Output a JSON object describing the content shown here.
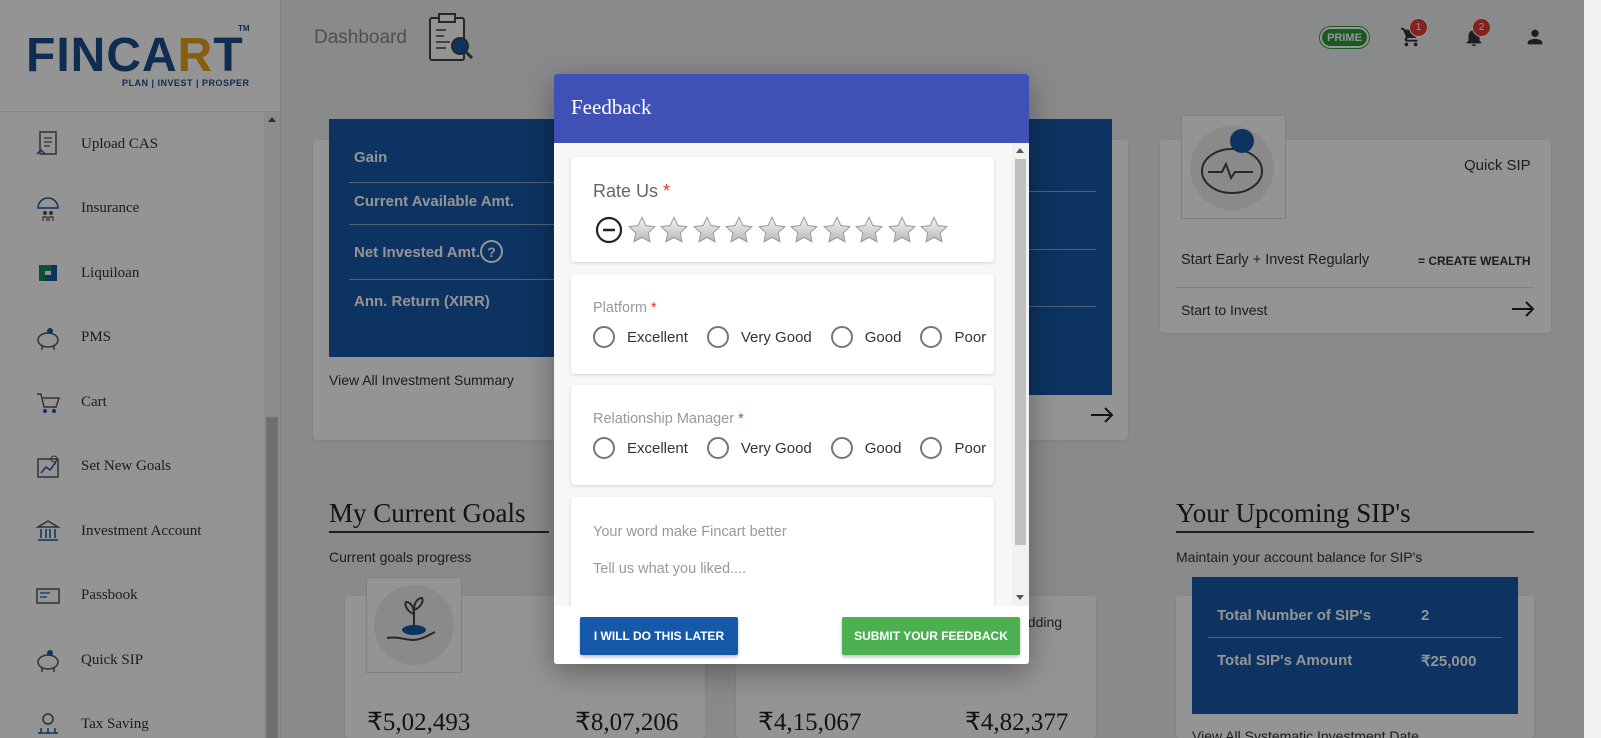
{
  "sidebar": {
    "brand": {
      "prefix": "FINCA",
      "accent": "R",
      "suffix": "T",
      "tm": "TM",
      "tagline": "PLAN | INVEST | PROSPER"
    },
    "items": [
      {
        "label": "Upload CAS",
        "icon": "upload-document-icon"
      },
      {
        "label": "Insurance",
        "icon": "umbrella-family-icon"
      },
      {
        "label": "Liquiloan",
        "icon": "liquiloan-logo-icon"
      },
      {
        "label": "PMS",
        "icon": "piggy-bank-icon"
      },
      {
        "label": "Cart",
        "icon": "cart-icon"
      },
      {
        "label": "Set New Goals",
        "icon": "goal-chart-icon"
      },
      {
        "label": "Investment Account",
        "icon": "bank-building-icon"
      },
      {
        "label": "Passbook",
        "icon": "passbook-icon"
      },
      {
        "label": "Quick SIP",
        "icon": "piggy-bank-icon"
      },
      {
        "label": "Tax Saving",
        "icon": "tax-saving-icon"
      }
    ]
  },
  "header": {
    "title": "Dashboard",
    "prime_label": "PRIME",
    "cart_count": "1",
    "notification_count": "2"
  },
  "summary": {
    "rows": [
      "Gain",
      "Current Available Amt.",
      "Net Invested Amt.",
      "Ann. Return (XIRR)"
    ],
    "help_symbol": "?",
    "view_all": "View All Investment Summary"
  },
  "quick_sip": {
    "title": "Quick SIP",
    "tagline": "Start Early + Invest Regularly",
    "tagline_right": "= CREATE WEALTH",
    "cta": "Start to Invest"
  },
  "goals": {
    "title": "My Current Goals",
    "subtitle": "Current goals progress",
    "wedding_partial": "edding",
    "amounts": [
      "₹5,02,493",
      "₹8,07,206",
      "₹4,15,067",
      "₹4,82,377"
    ]
  },
  "sip": {
    "title": "Your Upcoming SIP's",
    "subtitle": "Maintain your account balance for SIP's",
    "rows": [
      {
        "label": "Total Number of SIP's",
        "value": "2"
      },
      {
        "label": "Total SIP's Amount",
        "value": "₹25,000"
      }
    ],
    "view_all": "View All Systematic Investment Date"
  },
  "modal": {
    "title": "Feedback",
    "rate_label": "Rate Us",
    "required_mark": "*",
    "star_count": 10,
    "platform_label": "Platform",
    "rm_label": "Relationship Manager",
    "options": [
      "Excellent",
      "Very Good",
      "Good",
      "Poor"
    ],
    "comment_label": "Your word make Fincart better",
    "comment_placeholder": "Tell us what you liked....",
    "later_button": "I WILL DO THIS LATER",
    "submit_button": "SUBMIT YOUR FEEDBACK"
  },
  "colors": {
    "modal_header": "#3f51b5",
    "brand_blue": "#1559a8",
    "success_green": "#4caf50",
    "badge_red": "#e53935"
  }
}
